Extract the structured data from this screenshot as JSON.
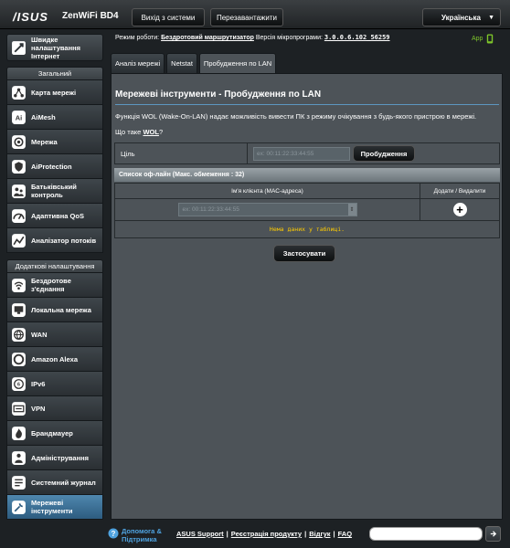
{
  "header": {
    "logo": "/ISUS",
    "model": "ZenWiFi BD4",
    "logout": "Вихід з системи",
    "reboot": "Перезавантажити",
    "language": "Українська"
  },
  "status": {
    "mode_label": "Режим роботи:",
    "mode_value": "Бездротовий маршрутизатор",
    "fw_label": "Версія мікропрограми:",
    "fw_value": "3.0.0.6.102_56259",
    "app_label": "App"
  },
  "sidebar": {
    "qis": "Швидке налаштування Інтернет",
    "general_header": "Загальний",
    "general": [
      {
        "label": "Карта мережі",
        "icon": "network-map-icon"
      },
      {
        "label": "AiMesh",
        "icon": "aimesh-icon"
      },
      {
        "label": "Мережа",
        "icon": "network-icon"
      },
      {
        "label": "AiProtection",
        "icon": "aiprotection-icon"
      },
      {
        "label": "Батьківський контроль",
        "icon": "parental-control-icon"
      },
      {
        "label": "Адаптивна QoS",
        "icon": "qos-icon"
      },
      {
        "label": "Аналізатор потоків",
        "icon": "traffic-analyzer-icon"
      }
    ],
    "advanced_header": "Додаткові налаштування",
    "advanced": [
      {
        "label": "Бездротове з'єднання",
        "icon": "wireless-icon"
      },
      {
        "label": "Локальна мережа",
        "icon": "lan-icon"
      },
      {
        "label": "WAN",
        "icon": "wan-icon"
      },
      {
        "label": "Amazon Alexa",
        "icon": "alexa-icon"
      },
      {
        "label": "IPv6",
        "icon": "ipv6-icon"
      },
      {
        "label": "VPN",
        "icon": "vpn-icon"
      },
      {
        "label": "Брандмауер",
        "icon": "firewall-icon"
      },
      {
        "label": "Адміністрування",
        "icon": "administration-icon"
      },
      {
        "label": "Системний журнал",
        "icon": "system-log-icon"
      },
      {
        "label": "Мережеві інструменти",
        "icon": "network-tools-icon",
        "active": true
      }
    ]
  },
  "tabs": [
    "Аналіз мережі",
    "Netstat",
    "Пробудження по LAN"
  ],
  "main": {
    "title": "Мережеві інструменти - Пробудження по LAN",
    "description": "Функція WOL (Wake-On-LAN) надає можливість вивести ПК з режиму очікування з будь-якого пристрою в мережі.",
    "whatis_prefix": "Що таке",
    "whatis_link": "WOL",
    "whatis_suffix": "?",
    "target_label": "Ціль",
    "target_placeholder": "ex: 00:11:22:33:44:55",
    "wake_button": "Пробудження",
    "offline_list_header": "Список оф-лайн (Макс. обмеження : 32)",
    "col_client": "Ім'я клієнта (MAC-адреса)",
    "col_add_delete": "Додати / Видалити",
    "client_placeholder": "ex: 00:11:22:33:44:55",
    "no_data": "Нема даних у таблиці.",
    "apply_button": "Застосувати"
  },
  "footer": {
    "help": "Допомога & Підтримка",
    "links": [
      "ASUS Support",
      "Реєстрація продукту",
      "Відгук",
      "FAQ"
    ],
    "separator": "|"
  }
}
